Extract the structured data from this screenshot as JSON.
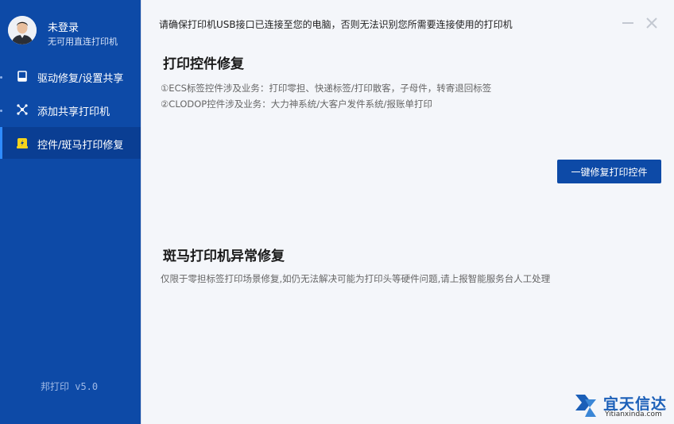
{
  "sidebar": {
    "profile": {
      "name": "未登录",
      "subtitle": "无可用直连打印机"
    },
    "items": [
      {
        "label": "驱动修复/设置共享",
        "icon": "printer-icon",
        "active": false
      },
      {
        "label": "添加共享打印机",
        "icon": "network-icon",
        "active": false
      },
      {
        "label": "控件/斑马打印修复",
        "icon": "repair-icon",
        "active": true
      }
    ],
    "version": "邦打印 v5.0"
  },
  "main": {
    "notice": "请确保打印机USB接口已连接至您的电脑，否则无法识别您所需要连接使用的打印机",
    "section1": {
      "title": "打印控件修复",
      "lines": [
        "①ECS标签控件涉及业务：打印零担、快递标签/打印散客，子母件，转寄退回标签",
        "②CLODOP控件涉及业务：大力神系统/大客户发件系统/报账单打印"
      ],
      "button": "一键修复打印控件"
    },
    "section2": {
      "title": "斑马打印机异常修复",
      "desc": "仅限于零担标签打印场景修复,如仍无法解决可能为打印头等硬件问题,请上报智能服务台人工处理"
    }
  },
  "watermark": {
    "cn": "宜天信达",
    "en": "Yitianxinda.com"
  },
  "colors": {
    "sidebar": "#0d4aa7",
    "sidebar_active": "#0a3e93",
    "accent": "#2f8cff",
    "icon_yellow": "#f5d31c",
    "main_bg": "#f4f6fa"
  }
}
